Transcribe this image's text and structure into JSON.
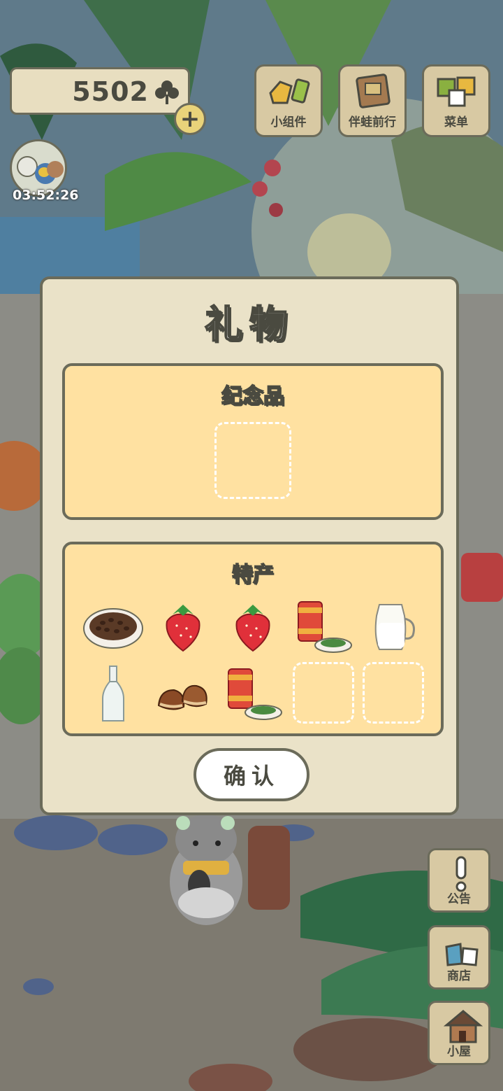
{
  "hud": {
    "clover_count": "5502",
    "add_label": "+",
    "visitor_timer": "03:52:26"
  },
  "top_buttons": [
    {
      "label": "小组件",
      "icon": "widget-icon"
    },
    {
      "label": "伴蛙前行",
      "icon": "travel-book-icon"
    },
    {
      "label": "菜单",
      "icon": "menu-icon"
    }
  ],
  "dialog": {
    "title": "礼物",
    "souvenir": {
      "title": "纪念品"
    },
    "specialty": {
      "title": "特产",
      "items": [
        {
          "name": "roasted-beans-plate"
        },
        {
          "name": "strawberry"
        },
        {
          "name": "strawberry"
        },
        {
          "name": "tea-can-with-leaves"
        },
        {
          "name": "milk-jug"
        },
        {
          "name": "glass-bottle"
        },
        {
          "name": "chestnuts"
        },
        {
          "name": "tea-can-with-leaves"
        }
      ],
      "empty_slots": 2
    },
    "confirm_label": "确认"
  },
  "side_buttons": [
    {
      "label": "公告",
      "icon": "exclamation-icon"
    },
    {
      "label": "商店",
      "icon": "shop-bags-icon"
    },
    {
      "label": "小屋",
      "icon": "house-icon"
    }
  ],
  "colors": {
    "outline": "#6b6b5a",
    "panel": "#ffe1a1",
    "dialog_bg": "#eae2c8",
    "button_bg": "#d8c9a3"
  }
}
